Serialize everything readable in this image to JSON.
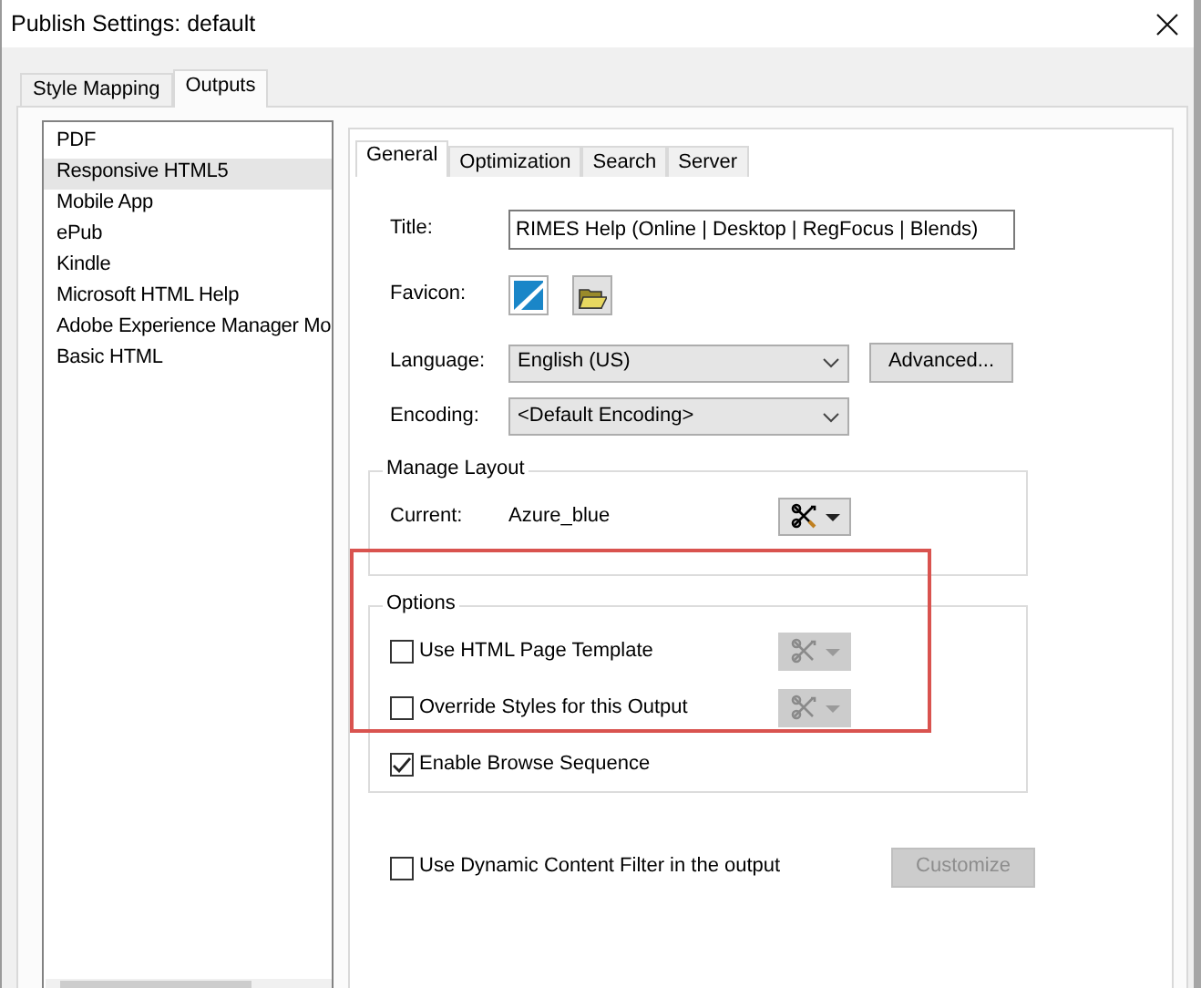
{
  "window": {
    "title": "Publish Settings: default"
  },
  "tabs": [
    {
      "label": "Style Mapping",
      "selected": false
    },
    {
      "label": "Outputs",
      "selected": true
    }
  ],
  "outputs": [
    {
      "label": "PDF",
      "selected": false
    },
    {
      "label": "Responsive HTML5",
      "selected": true
    },
    {
      "label": "Mobile App",
      "selected": false
    },
    {
      "label": "ePub",
      "selected": false
    },
    {
      "label": "Kindle",
      "selected": false
    },
    {
      "label": "Microsoft HTML Help",
      "selected": false
    },
    {
      "label": "Adobe Experience Manager Mo",
      "selected": false
    },
    {
      "label": "Basic HTML",
      "selected": false
    }
  ],
  "inner_tabs": [
    {
      "label": "General",
      "selected": true
    },
    {
      "label": "Optimization",
      "selected": false
    },
    {
      "label": "Search",
      "selected": false
    },
    {
      "label": "Server",
      "selected": false
    }
  ],
  "title_field": {
    "label": "Title:",
    "value": "RIMES Help (Online | Desktop | RegFocus | Blends)"
  },
  "favicon": {
    "label": "Favicon:"
  },
  "language": {
    "label": "Language:",
    "value": "English (US)",
    "button": "Advanced..."
  },
  "encoding": {
    "label": "Encoding:",
    "value": "<Default Encoding>"
  },
  "manage_layout": {
    "legend": "Manage Layout",
    "current_label": "Current:",
    "current_value": "Azure_blue",
    "tool_disabled": false
  },
  "options": {
    "legend": "Options",
    "items": [
      {
        "kind": "tool",
        "label": "Use HTML Page Template",
        "checked": false,
        "tool_disabled": true
      },
      {
        "kind": "tool",
        "label": "Override Styles for this Output",
        "checked": false,
        "tool_disabled": true
      },
      {
        "kind": "plain",
        "label": "Enable Browse Sequence",
        "checked": true
      }
    ]
  },
  "dynamic_filter": {
    "label": "Use Dynamic Content Filter in the output",
    "checked": false,
    "button": "Customize",
    "button_disabled": true
  }
}
